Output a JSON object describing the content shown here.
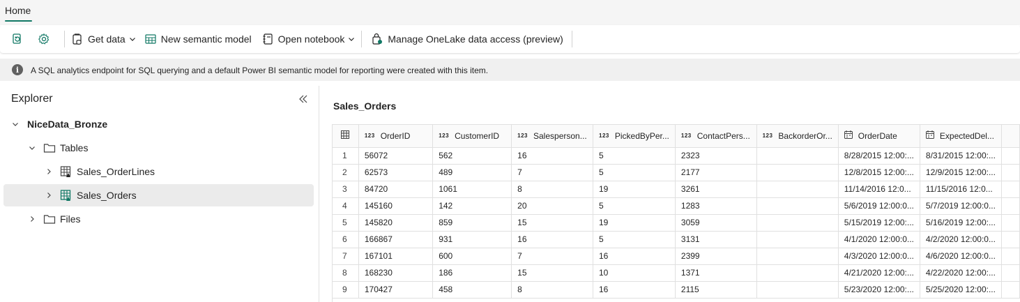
{
  "tabs": {
    "home": "Home"
  },
  "toolbar": {
    "get_data": "Get data",
    "new_semantic_model": "New semantic model",
    "open_notebook": "Open notebook",
    "manage_onelake": "Manage OneLake data access (preview)"
  },
  "info": {
    "message": "A SQL analytics endpoint for SQL querying and a default Power BI semantic model for reporting were created with this item."
  },
  "explorer": {
    "title": "Explorer",
    "lakehouse": "NiceData_Bronze",
    "tables_folder": "Tables",
    "tables": [
      "Sales_OrderLines",
      "Sales_Orders"
    ],
    "selected_table": "Sales_Orders",
    "files_folder": "Files"
  },
  "main": {
    "title": "Sales_Orders",
    "columns": [
      {
        "label": "OrderID",
        "type": "123"
      },
      {
        "label": "CustomerID",
        "type": "123"
      },
      {
        "label": "Salesperson...",
        "type": "123"
      },
      {
        "label": "PickedByPer...",
        "type": "123"
      },
      {
        "label": "ContactPers...",
        "type": "123"
      },
      {
        "label": "BackorderOr...",
        "type": "123"
      },
      {
        "label": "OrderDate",
        "type": "date"
      },
      {
        "label": "ExpectedDel...",
        "type": "date"
      }
    ],
    "rows": [
      [
        "1",
        "56072",
        "562",
        "16",
        "5",
        "2323",
        "",
        "8/28/2015 12:00:...",
        "8/31/2015 12:00:..."
      ],
      [
        "2",
        "62573",
        "489",
        "7",
        "5",
        "2177",
        "",
        "12/8/2015 12:00:...",
        "12/9/2015 12:00:..."
      ],
      [
        "3",
        "84720",
        "1061",
        "8",
        "19",
        "3261",
        "",
        "11/14/2016 12:0...",
        "11/15/2016 12:0..."
      ],
      [
        "4",
        "145160",
        "142",
        "20",
        "5",
        "1283",
        "",
        "5/6/2019 12:00:0...",
        "5/7/2019 12:00:0..."
      ],
      [
        "5",
        "145820",
        "859",
        "15",
        "19",
        "3059",
        "",
        "5/15/2019 12:00:...",
        "5/16/2019 12:00:..."
      ],
      [
        "6",
        "166867",
        "931",
        "16",
        "5",
        "3131",
        "",
        "4/1/2020 12:00:0...",
        "4/2/2020 12:00:0..."
      ],
      [
        "7",
        "167101",
        "600",
        "7",
        "16",
        "2399",
        "",
        "4/3/2020 12:00:0...",
        "4/6/2020 12:00:0..."
      ],
      [
        "8",
        "168230",
        "186",
        "15",
        "10",
        "1371",
        "",
        "4/21/2020 12:00:...",
        "4/22/2020 12:00:..."
      ],
      [
        "9",
        "170427",
        "458",
        "8",
        "16",
        "2115",
        "",
        "5/23/2020 12:00:...",
        "5/25/2020 12:00:..."
      ]
    ]
  },
  "colors": {
    "accent": "#117865",
    "table_icon": "#117865"
  }
}
